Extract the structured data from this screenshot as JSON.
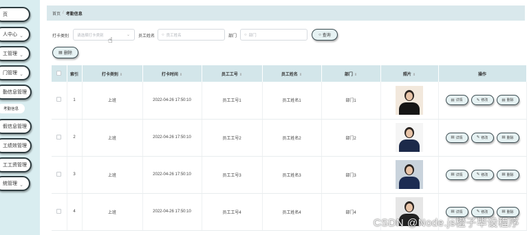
{
  "sidebar": {
    "items": [
      {
        "label": "页",
        "has_chevron": false
      },
      {
        "label": "人中心",
        "has_chevron": true
      },
      {
        "label": "工管理",
        "has_chevron": true
      },
      {
        "label": "门管理",
        "has_chevron": true
      },
      {
        "label": "勤信息管理",
        "has_chevron": false
      },
      {
        "label": "假信息管理",
        "has_chevron": false
      },
      {
        "label": "工绩效管理",
        "has_chevron": false
      },
      {
        "label": "工工资管理",
        "has_chevron": false
      },
      {
        "label": "统管理",
        "has_chevron": true
      }
    ],
    "sub_item": "考勤信息"
  },
  "breadcrumb": {
    "home": "首页",
    "separator": "/",
    "current": "考勤信息"
  },
  "filters": {
    "punch_type_label": "打卡类别",
    "punch_type_placeholder": "请选择打卡类别",
    "emp_name_label": "员工姓名",
    "emp_name_placeholder": "员工姓名",
    "dept_label": "部门",
    "dept_placeholder": "部门",
    "search_button": "查询",
    "delete_button": "删除"
  },
  "table": {
    "columns": [
      "索引",
      "打卡类别",
      "打卡时间",
      "员工工号",
      "员工姓名",
      "部门",
      "照片",
      "操作"
    ],
    "rows": [
      {
        "index": "1",
        "type": "上班",
        "time": "2022-04-26 17:50:10",
        "emp_no": "员工工号1",
        "emp_name": "员工姓名1",
        "dept": "部门1"
      },
      {
        "index": "2",
        "type": "上班",
        "time": "2022-04-26 17:50:10",
        "emp_no": "员工工号2",
        "emp_name": "员工姓名2",
        "dept": "部门2"
      },
      {
        "index": "3",
        "type": "上班",
        "time": "2022-04-26 17:50:10",
        "emp_no": "员工工号3",
        "emp_name": "员工姓名3",
        "dept": "部门3"
      },
      {
        "index": "4",
        "type": "上班",
        "time": "2022-04-26 17:50:10",
        "emp_no": "员工工号4",
        "emp_name": "员工姓名4",
        "dept": "部门4"
      }
    ],
    "actions": {
      "detail": "详情",
      "edit": "修改",
      "delete": "删除"
    }
  },
  "watermark": "CSDN @Node.js橙子毕设程序",
  "colors": {
    "sidebar_bg": "#d9edf0",
    "header_bg": "#d3e6ea",
    "pill_bg": "#e6f2f3",
    "pill_border": "#3a4a4f"
  }
}
